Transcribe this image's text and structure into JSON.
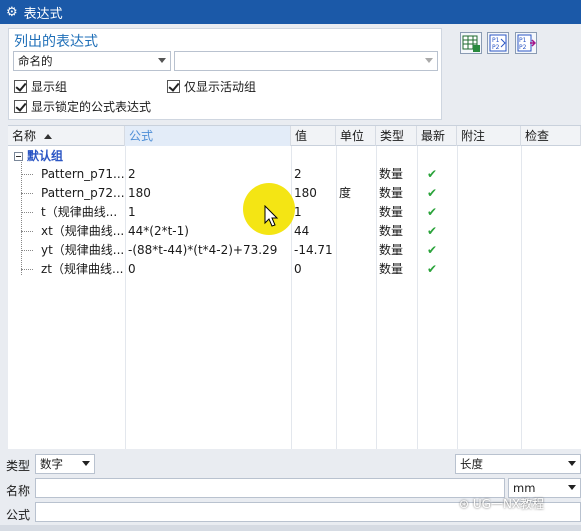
{
  "window": {
    "title": "表达式"
  },
  "list_panel": {
    "title": "列出的表达式",
    "filter_select": "命名的",
    "filter_text_select": "",
    "checkboxes": [
      {
        "label": "显示组",
        "checked": true
      },
      {
        "label": "仅显示活动组",
        "checked": true
      },
      {
        "label": "显示锁定的公式表达式",
        "checked": true
      }
    ]
  },
  "table": {
    "columns": [
      "名称",
      "公式",
      "值",
      "单位",
      "类型",
      "最新",
      "附注",
      "检查"
    ],
    "group": "默认组",
    "rows": [
      {
        "name": "Pattern_p71...",
        "formula": "2",
        "value": "2",
        "unit": "",
        "type": "数量",
        "latest": "✔"
      },
      {
        "name": "Pattern_p72...",
        "formula": "180",
        "value": "180",
        "unit": "度",
        "type": "数量",
        "latest": "✔"
      },
      {
        "name": "t（规律曲线...",
        "formula": "1",
        "value": "1",
        "unit": "",
        "type": "数量",
        "latest": "✔"
      },
      {
        "name": "xt（规律曲线...",
        "formula": "44*(2*t-1)",
        "value": "44",
        "unit": "",
        "type": "数量",
        "latest": "✔"
      },
      {
        "name": "yt（规律曲线...",
        "formula": "-(88*t-44)*(t*4-2)+73.29",
        "value": "-14.71",
        "unit": "",
        "type": "数量",
        "latest": "✔"
      },
      {
        "name": "zt（规律曲线...",
        "formula": "0",
        "value": "0",
        "unit": "",
        "type": "数量",
        "latest": "✔"
      }
    ]
  },
  "bottom": {
    "type_label": "类型",
    "type_value": "数字",
    "dimension_value": "长度",
    "name_label": "名称",
    "name_value": "",
    "unit_value": "mm",
    "formula_label": "公式",
    "formula_value": ""
  },
  "watermark": "UG一NX教程",
  "colors": {
    "titlebar": "#1b59a8",
    "accent": "#1f6fb8",
    "check": "#2aa33a"
  }
}
